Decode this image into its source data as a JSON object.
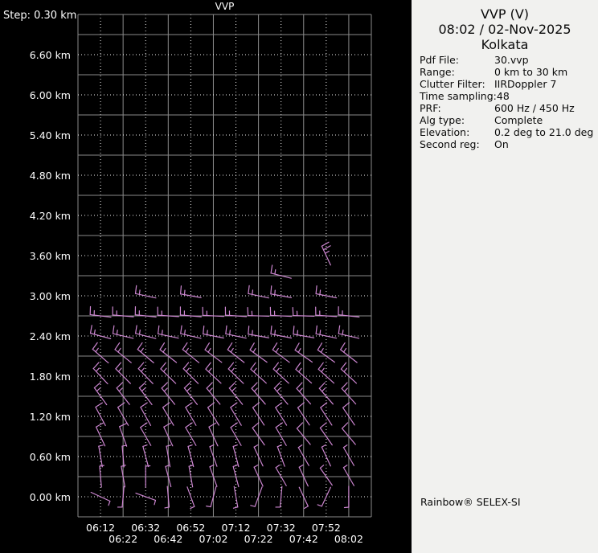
{
  "colors": {
    "background": "#000000",
    "panel_background": "#f1f1ef",
    "grid_solid": "#8a8a8a",
    "grid_dotted": "#f0f0f0",
    "barb": "#cc86d0",
    "text_light": "#ffffff",
    "text_dark": "#0a0a0a"
  },
  "chart_data": {
    "type": "wind-barb-time-height-profile",
    "plot_title": "VVP",
    "step_label": "Step: 0.30 km",
    "grid": "on, solid lines every 0.30 km / 10 min alternating with dotted lines at labeled levels",
    "y_axis": {
      "unit": "km",
      "step_km": 0.3,
      "top_km": 7.2,
      "bottom_km": -0.3,
      "tick_labels": [
        "6.60 km",
        "6.00 km",
        "5.40 km",
        "4.80 km",
        "4.20 km",
        "3.60 km",
        "3.00 km",
        "2.40 km",
        "1.80 km",
        "1.20 km",
        "0.60 km",
        "0.00 km"
      ],
      "tick_values_km": [
        6.6,
        6.0,
        5.4,
        4.8,
        4.2,
        3.6,
        3.0,
        2.4,
        1.8,
        1.2,
        0.6,
        0.0
      ]
    },
    "x_axis": {
      "unit": "time (UTC)",
      "labels_row1": [
        "06:12",
        "06:32",
        "06:52",
        "07:12",
        "07:32",
        "07:52"
      ],
      "labels_row2": [
        "06:22",
        "06:42",
        "07:02",
        "07:22",
        "07:42",
        "08:02"
      ]
    },
    "times": [
      "06:12",
      "06:22",
      "06:32",
      "06:42",
      "06:52",
      "07:02",
      "07:12",
      "07:22",
      "07:32",
      "07:42",
      "07:52",
      "08:02"
    ],
    "barb_rows": [
      {
        "h_km": 0.0,
        "spd_kt": 5,
        "dirs": [
          115,
          185,
          110,
          175,
          160,
          195,
          170,
          200,
          185,
          155,
          205,
          180
        ]
      },
      {
        "h_km": 0.3,
        "spd_kt": 5,
        "dirs": [
          355,
          350,
          0,
          345,
          350,
          340,
          345,
          335,
          330,
          335,
          325,
          330
        ]
      },
      {
        "h_km": 0.6,
        "spd_kt": 5,
        "dirs": [
          350,
          355,
          345,
          350,
          345,
          340,
          345,
          335,
          340,
          330,
          335,
          330
        ]
      },
      {
        "h_km": 0.9,
        "spd_kt": 10,
        "dirs": [
          335,
          340,
          330,
          335,
          330,
          335,
          330,
          325,
          330,
          320,
          325,
          320
        ]
      },
      {
        "h_km": 1.2,
        "spd_kt": 10,
        "dirs": [
          332,
          330,
          331,
          329,
          330,
          328,
          329,
          327,
          328,
          326,
          327,
          326
        ]
      },
      {
        "h_km": 1.5,
        "spd_kt": 15,
        "dirs": [
          324,
          322,
          323,
          321,
          322,
          320,
          321,
          319,
          320,
          318,
          319,
          318
        ]
      },
      {
        "h_km": 1.8,
        "spd_kt": 15,
        "dirs": [
          317,
          315,
          316,
          314,
          315,
          313,
          314,
          312,
          313,
          311,
          312,
          313
        ]
      },
      {
        "h_km": 2.1,
        "spd_kt": 15,
        "dirs": [
          311,
          309,
          310,
          308,
          309,
          307,
          308,
          306,
          307,
          305,
          306,
          308
        ]
      },
      {
        "h_km": 2.4,
        "spd_kt": 15,
        "dirs": [
          285,
          283,
          284,
          282,
          283,
          281,
          282,
          280,
          281,
          280,
          282,
          283
        ]
      },
      {
        "h_km": 2.7,
        "spd_kt": 15,
        "dirs": [
          277,
          275,
          276,
          274,
          275,
          273,
          274,
          272,
          273,
          272,
          274,
          276
        ]
      },
      {
        "h_km": 3.0,
        "spd_kt": 15,
        "cols": [
          "06:32",
          "06:52",
          "07:22",
          "07:32",
          "07:52"
        ],
        "dirs": [
          282,
          280,
          282,
          280,
          281
        ]
      },
      {
        "h_km": 3.3,
        "spd_kt": 15,
        "cols": [
          "07:32"
        ],
        "dirs": [
          284
        ]
      },
      {
        "h_km": 3.6,
        "spd_kt": 25,
        "cols": [
          "07:52"
        ],
        "dirs": [
          335
        ]
      }
    ]
  },
  "info_panel": {
    "title": "VVP (V)",
    "datetime": "08:02 / 02-Nov-2025",
    "station": "Kolkata",
    "fields": [
      {
        "label": "Pdf File:",
        "value": "30.vvp"
      },
      {
        "label": "Range:",
        "value": "0 km to 30 km"
      },
      {
        "label": "Clutter Filter:",
        "value": "IIRDoppler 7"
      },
      {
        "label": "Time sampling:",
        "value": "48"
      },
      {
        "label": "PRF:",
        "value": "600 Hz / 450 Hz"
      },
      {
        "label": "Alg type:",
        "value": "Complete"
      },
      {
        "label": "Elevation:",
        "value": "0.2 deg to 21.0 deg"
      },
      {
        "label": "Second reg:",
        "value": "On"
      }
    ],
    "footer": "Rainbow® SELEX-SI"
  }
}
